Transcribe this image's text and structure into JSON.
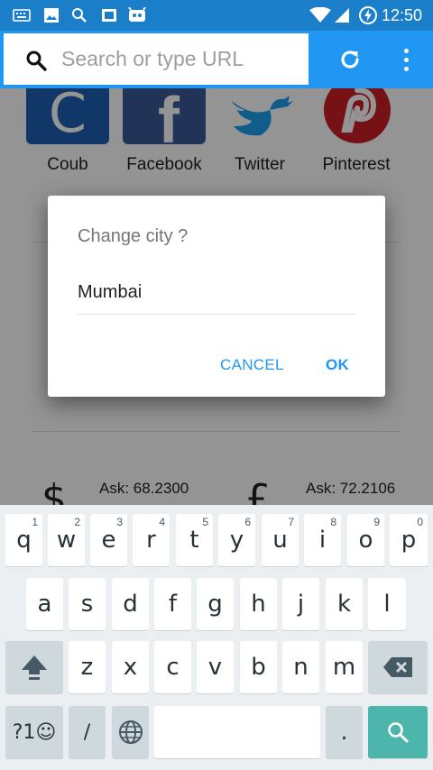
{
  "status_bar": {
    "time": "12:50",
    "icons": [
      "keyboard-icon",
      "image-icon",
      "search-icon",
      "tablet-icon",
      "android-icon",
      "wifi-icon",
      "signal-icon",
      "battery-charging-icon"
    ],
    "color": "#1a7fc8"
  },
  "url_bar": {
    "placeholder": "Search or type URL",
    "color": "#2196f3"
  },
  "speed_dial": [
    {
      "label": "Coub",
      "letter": "C",
      "color": "#1e5fb4"
    },
    {
      "label": "Facebook",
      "letter": "f",
      "color": "#3b5998"
    },
    {
      "label": "Twitter",
      "letter": "",
      "color": "#1da1f2"
    },
    {
      "label": "Pinterest",
      "letter": "",
      "color": "#cb2027"
    }
  ],
  "rates": {
    "dollar_symbol": "$",
    "pound_symbol": "£",
    "usd_ask": "Ask: 68.2300",
    "gbp_ask": "Ask: 72.2106"
  },
  "dialog": {
    "title": "Change city ?",
    "city_value": "Mumbai",
    "cancel_label": "CANCEL",
    "ok_label": "OK"
  },
  "keyboard": {
    "row1": [
      {
        "key": "q",
        "hint": "1"
      },
      {
        "key": "w",
        "hint": "2"
      },
      {
        "key": "e",
        "hint": "3"
      },
      {
        "key": "r",
        "hint": "4"
      },
      {
        "key": "t",
        "hint": "5"
      },
      {
        "key": "y",
        "hint": "6"
      },
      {
        "key": "u",
        "hint": "7"
      },
      {
        "key": "i",
        "hint": "8"
      },
      {
        "key": "o",
        "hint": "9"
      },
      {
        "key": "p",
        "hint": "0"
      }
    ],
    "row2": [
      "a",
      "s",
      "d",
      "f",
      "g",
      "h",
      "j",
      "k",
      "l"
    ],
    "row3": [
      "z",
      "x",
      "c",
      "v",
      "b",
      "n",
      "m"
    ],
    "symbols_label": "?1☺",
    "slash_label": "/",
    "period_label": ".",
    "accent": "#4db6ac"
  }
}
